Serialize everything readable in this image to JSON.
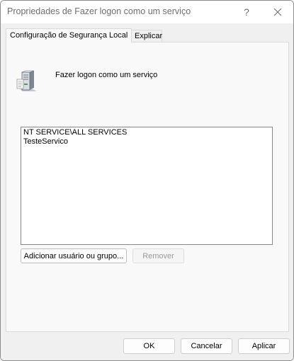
{
  "window": {
    "title": "Propriedades de Fazer logon como um serviço",
    "help_label": "?"
  },
  "tabs": [
    {
      "label": "Configuração de Segurança Local",
      "active": true
    },
    {
      "label": "Explicar",
      "active": false
    }
  ],
  "policy": {
    "name": "Fazer logon como um serviço",
    "icon": "server-policy-icon"
  },
  "accounts": [
    "NT SERVICE\\ALL SERVICES",
    "TesteServico"
  ],
  "actions": {
    "add_label": "Adicionar usuário ou grupo...",
    "remove_label": "Remover"
  },
  "footer": {
    "ok_label": "OK",
    "cancel_label": "Cancelar",
    "apply_label": "Aplicar"
  }
}
